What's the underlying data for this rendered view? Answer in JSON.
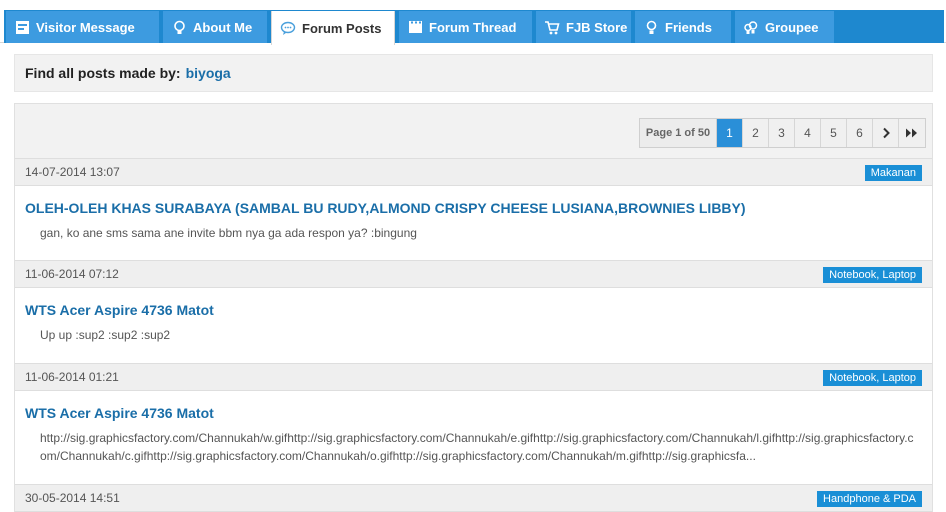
{
  "tabs": [
    {
      "id": "visitor",
      "label": "Visitor Message",
      "icon": "visitor-message-icon",
      "active": false
    },
    {
      "id": "about",
      "label": "About Me",
      "icon": "about-me-icon",
      "active": false
    },
    {
      "id": "posts",
      "label": "Forum Posts",
      "icon": "speech-bubble-icon",
      "active": true
    },
    {
      "id": "thread",
      "label": "Forum Thread",
      "icon": "film-icon",
      "active": false
    },
    {
      "id": "store",
      "label": "FJB Store",
      "icon": "cart-icon",
      "active": false
    },
    {
      "id": "friends",
      "label": "Friends",
      "icon": "person-icon",
      "active": false
    },
    {
      "id": "groupee",
      "label": "Groupee",
      "icon": "group-icon",
      "active": false
    }
  ],
  "header": {
    "label": "Find all posts made by:",
    "username": "biyoga"
  },
  "pagination": {
    "info": "Page 1 of 50",
    "pages": [
      "1",
      "2",
      "3",
      "4",
      "5",
      "6"
    ],
    "current": "1",
    "next": "›",
    "last": "»"
  },
  "posts": [
    {
      "date": "14-07-2014 13:07",
      "category": "Makanan",
      "title": "OLEH-OLEH KHAS SURABAYA (SAMBAL BU RUDY,ALMOND CRISPY CHEESE LUSIANA,BROWNIES LIBBY)",
      "message": "gan, ko ane sms sama ane invite bbm nya ga ada respon ya? :bingung"
    },
    {
      "date": "11-06-2014 07:12",
      "category": "Notebook, Laptop",
      "title": "WTS Acer Aspire 4736 Matot",
      "message": "Up up :sup2 :sup2 :sup2"
    },
    {
      "date": "11-06-2014 01:21",
      "category": "Notebook, Laptop",
      "title": "WTS Acer Aspire 4736 Matot",
      "message": "http://sig.graphicsfactory.com/Channukah/w.gifhttp://sig.graphicsfactory.com/Channukah/e.gifhttp://sig.graphicsfactory.com/Channukah/l.gifhttp://sig.graphicsfactory.com/Channukah/c.gifhttp://sig.graphicsfactory.com/Channukah/o.gifhttp://sig.graphicsfactory.com/Channukah/m.gifhttp://sig.graphicsfa..."
    },
    {
      "date": "30-05-2014 14:51",
      "category": "Handphone & PDA"
    }
  ]
}
